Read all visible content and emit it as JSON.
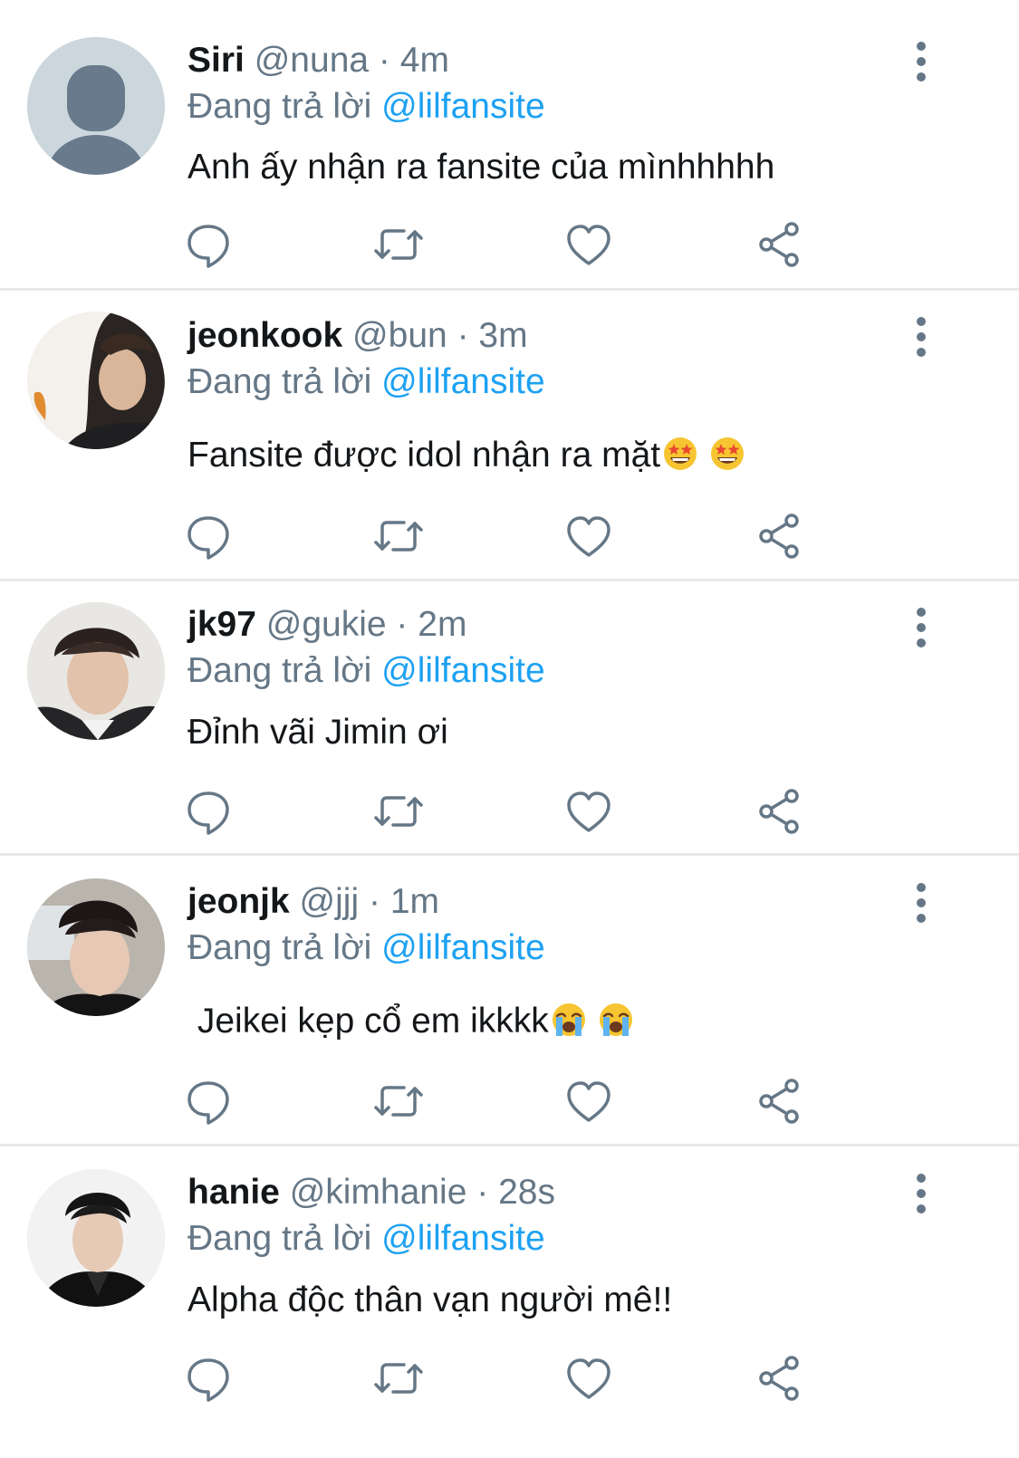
{
  "tweets": [
    {
      "name": "Siri",
      "handle": "@nuna",
      "separator": "·",
      "time": "4m",
      "reply_prefix": "Đang trả lời",
      "reply_to": "@lilfansite",
      "text": "Anh ấy nhận ra fansite của mìnhhhhh",
      "emojis": [],
      "avatar": "default-avatar-icon"
    },
    {
      "name": "jeonkook",
      "handle": "@bun",
      "separator": "·",
      "time": "3m",
      "reply_prefix": "Đang trả lời",
      "reply_to": "@lilfansite",
      "text": "Fansite được idol nhận ra mặt",
      "emojis": [
        "star-struck-emoji",
        "star-struck-emoji"
      ],
      "avatar": "profile-photo"
    },
    {
      "name": "jk97",
      "handle": "@gukie",
      "separator": "·",
      "time": "2m",
      "reply_prefix": "Đang trả lời",
      "reply_to": "@lilfansite",
      "text": "Đỉnh vãi Jimin ơi",
      "emojis": [],
      "avatar": "profile-photo"
    },
    {
      "name": "jeonjk",
      "handle": "@jjj",
      "separator": "·",
      "time": "1m",
      "reply_prefix": "Đang trả lời",
      "reply_to": "@lilfansite",
      "text": " Jeikei kẹp cổ em ikkkk",
      "emojis": [
        "loudly-crying-emoji",
        "loudly-crying-emoji"
      ],
      "avatar": "profile-photo"
    },
    {
      "name": "hanie",
      "handle": "@kimhanie",
      "separator": "·",
      "time": "28s",
      "reply_prefix": "Đang trả lời",
      "reply_to": "@lilfansite",
      "text": "Alpha độc thân vạn người mê!!",
      "emojis": [],
      "avatar": "profile-photo"
    }
  ],
  "icons": {
    "reply": "reply-icon",
    "retweet": "retweet-icon",
    "like": "like-icon",
    "share": "share-icon",
    "more": "more-options-icon"
  },
  "colors": {
    "primary_text": "#14171a",
    "secondary_text": "#657786",
    "mention": "#1da1f2",
    "divider": "#e6e9ec",
    "default_avatar_bg": "#ccd6dd",
    "default_avatar_fg": "#687a8b"
  }
}
